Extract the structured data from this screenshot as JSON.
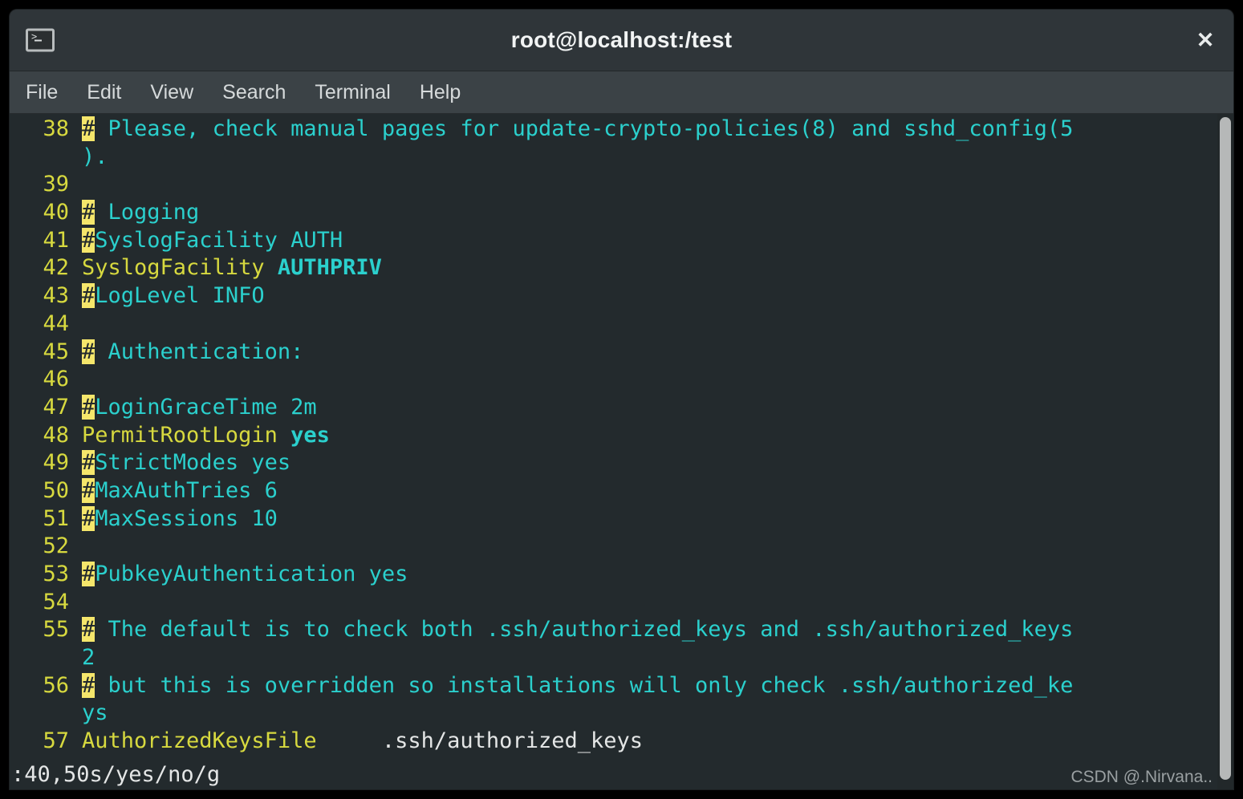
{
  "window": {
    "title": "root@localhost:/test",
    "icon": "terminal-icon",
    "close_label": "✕"
  },
  "menubar": {
    "items": [
      {
        "label": "File"
      },
      {
        "label": "Edit"
      },
      {
        "label": "View"
      },
      {
        "label": "Search"
      },
      {
        "label": "Terminal"
      },
      {
        "label": "Help"
      }
    ]
  },
  "colors": {
    "background": "#232a2d",
    "titlebar": "#2f3539",
    "menubar": "#3b4246",
    "comment": "#2bd0cd",
    "keyword": "#d7d93f",
    "linenumber": "#d7d93f",
    "plain": "#e4e6e6",
    "search_highlight_bg": "#f5e66b",
    "scrollbar_thumb": "#b6b8b8"
  },
  "editor": {
    "app": "vim",
    "file": "sshd_config",
    "lines": [
      {
        "num": "38",
        "hash": "#",
        "rest": " Please, check manual pages for update-crypto-policies(8) and sshd_config(5",
        "kind": "comment",
        "wrap": ")."
      },
      {
        "num": "39",
        "hash": "",
        "rest": "",
        "kind": "blank",
        "wrap": ""
      },
      {
        "num": "40",
        "hash": "#",
        "rest": " Logging",
        "kind": "comment",
        "wrap": ""
      },
      {
        "num": "41",
        "hash": "#",
        "rest": "SyslogFacility AUTH",
        "kind": "comment",
        "wrap": ""
      },
      {
        "num": "42",
        "hash": "",
        "kind": "config",
        "keyword": "SyslogFacility ",
        "value": "AUTHPRIV",
        "rest": "",
        "wrap": ""
      },
      {
        "num": "43",
        "hash": "#",
        "rest": "LogLevel INFO",
        "kind": "comment",
        "wrap": ""
      },
      {
        "num": "44",
        "hash": "",
        "rest": "",
        "kind": "blank",
        "wrap": ""
      },
      {
        "num": "45",
        "hash": "#",
        "rest": " Authentication:",
        "kind": "comment",
        "wrap": ""
      },
      {
        "num": "46",
        "hash": "",
        "rest": "",
        "kind": "blank",
        "wrap": ""
      },
      {
        "num": "47",
        "hash": "#",
        "rest": "LoginGraceTime 2m",
        "kind": "comment",
        "wrap": ""
      },
      {
        "num": "48",
        "hash": "",
        "kind": "config",
        "keyword": "PermitRootLogin ",
        "value": "yes",
        "rest": "",
        "wrap": ""
      },
      {
        "num": "49",
        "hash": "#",
        "rest": "StrictModes yes",
        "kind": "comment",
        "wrap": ""
      },
      {
        "num": "50",
        "hash": "#",
        "rest": "MaxAuthTries 6",
        "kind": "comment",
        "wrap": ""
      },
      {
        "num": "51",
        "hash": "#",
        "rest": "MaxSessions 10",
        "kind": "comment",
        "wrap": ""
      },
      {
        "num": "52",
        "hash": "",
        "rest": "",
        "kind": "blank",
        "wrap": ""
      },
      {
        "num": "53",
        "hash": "#",
        "rest": "PubkeyAuthentication yes",
        "kind": "comment",
        "wrap": ""
      },
      {
        "num": "54",
        "hash": "",
        "rest": "",
        "kind": "blank",
        "wrap": ""
      },
      {
        "num": "55",
        "hash": "#",
        "rest": " The default is to check both .ssh/authorized_keys and .ssh/authorized_keys",
        "kind": "comment",
        "wrap": "2"
      },
      {
        "num": "56",
        "hash": "#",
        "rest": " but this is overridden so installations will only check .ssh/authorized_ke",
        "kind": "comment",
        "wrap": "ys"
      },
      {
        "num": "57",
        "hash": "",
        "kind": "config-plain",
        "keyword": "AuthorizedKeysFile",
        "value": "     .ssh/authorized_keys",
        "rest": "",
        "wrap": ""
      }
    ],
    "command_line": ":40,50s/yes/no/g"
  },
  "watermark": {
    "text": "CSDN @.Nirvana.."
  }
}
